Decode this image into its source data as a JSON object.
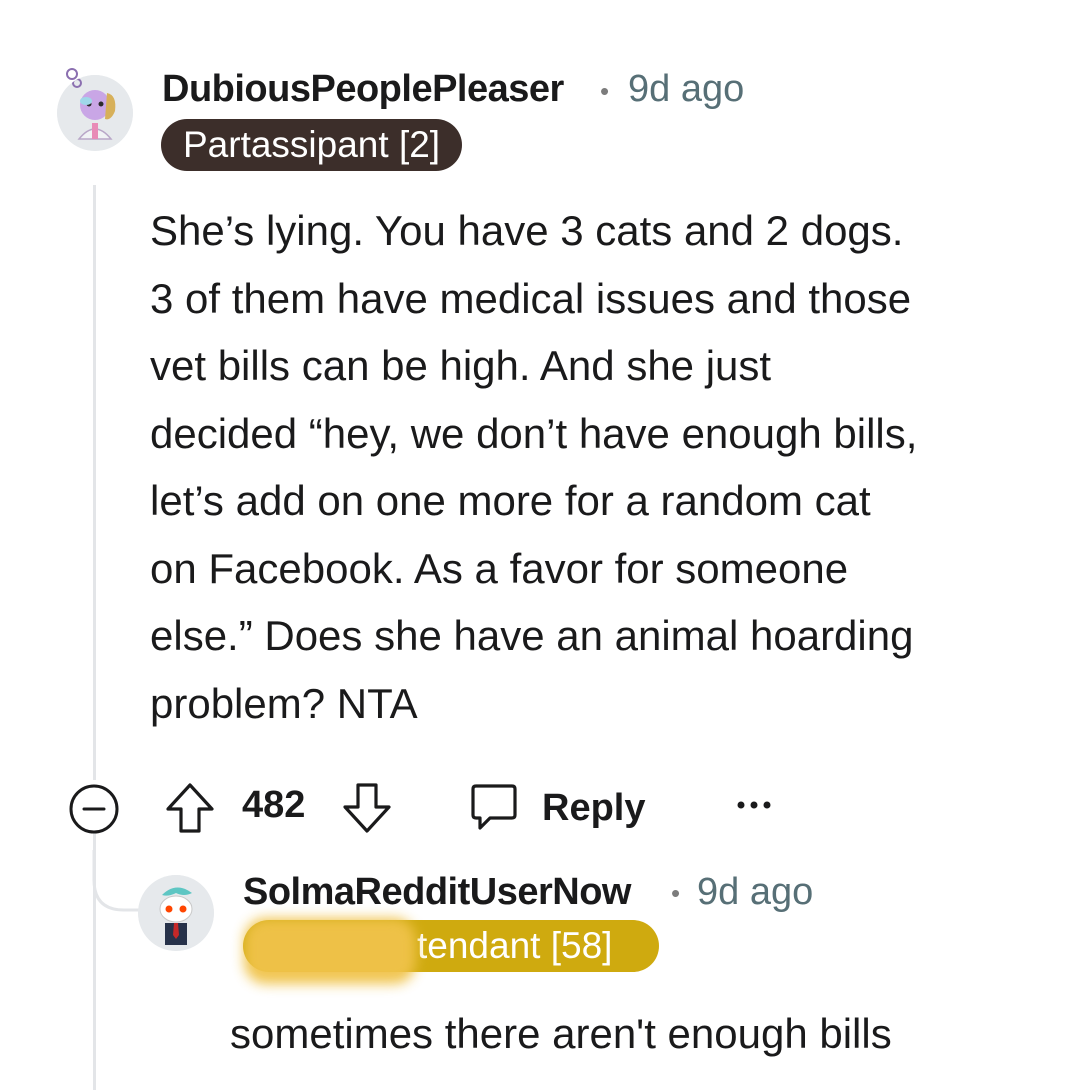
{
  "comment": {
    "username": "DubiousPeoplePleaser",
    "time": "9d ago",
    "flair": "Partassipant [2]",
    "flair_bg": "#3c2e2a",
    "flair_color": "#ffffff",
    "body_lines": [
      "She’s lying. You have 3 cats and 2 dogs.",
      "3 of them have medical issues and those",
      "vet bills can be high. And she just",
      "decided “hey, we don’t have enough bills,",
      "let’s add on one more for a random cat",
      "on Facebook. As a favor for someone",
      "else.” Does she have an animal hoarding",
      "problem? NTA"
    ],
    "votes": "482",
    "reply_label": "Reply",
    "more_icon": "ellipsis-icon",
    "collapse_icon": "collapse-icon",
    "upvote_icon": "upvote-arrow-icon",
    "downvote_icon": "downvote-arrow-icon",
    "reply_icon": "speech-bubble-icon"
  },
  "reply": {
    "username": "SolmaRedditUserNow",
    "time": "9d ago",
    "flair": "tendant [58]",
    "flair_bg": "#cfaa0f",
    "flair_color": "#ffffff",
    "body": "sometimes there aren't enough bills"
  }
}
